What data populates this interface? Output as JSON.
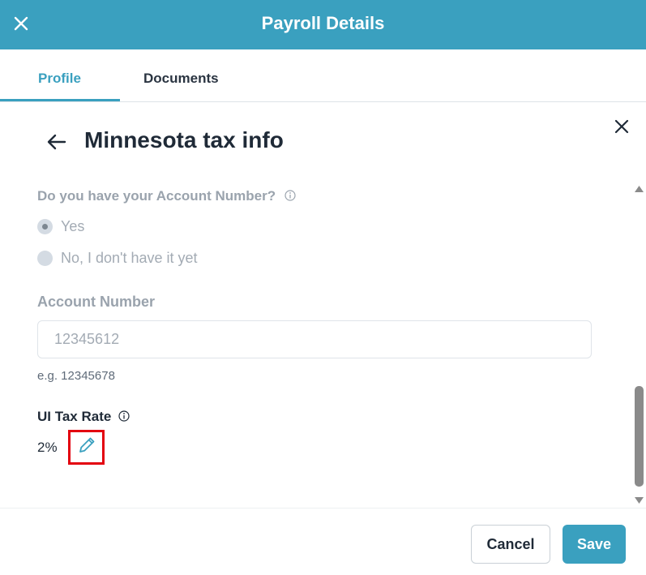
{
  "header": {
    "title": "Payroll Details",
    "close_icon": "close-icon"
  },
  "tabs": [
    {
      "label": "Profile",
      "active": true
    },
    {
      "label": "Documents",
      "active": false
    }
  ],
  "panel": {
    "title": "Minnesota tax info",
    "account_question": "Do you have your Account Number?",
    "options": [
      {
        "label": "Yes",
        "selected": true
      },
      {
        "label": "No, I don't have it yet",
        "selected": false
      }
    ],
    "account_number": {
      "label": "Account Number",
      "value": "12345612",
      "hint": "e.g. 12345678"
    },
    "ui_tax_rate": {
      "label": "UI Tax Rate",
      "value": "2%"
    }
  },
  "footer": {
    "cancel_label": "Cancel",
    "save_label": "Save"
  },
  "colors": {
    "accent": "#3aa0bf",
    "highlight": "#e3000f",
    "heading": "#1f2a37",
    "muted": "#9aa3ad"
  }
}
